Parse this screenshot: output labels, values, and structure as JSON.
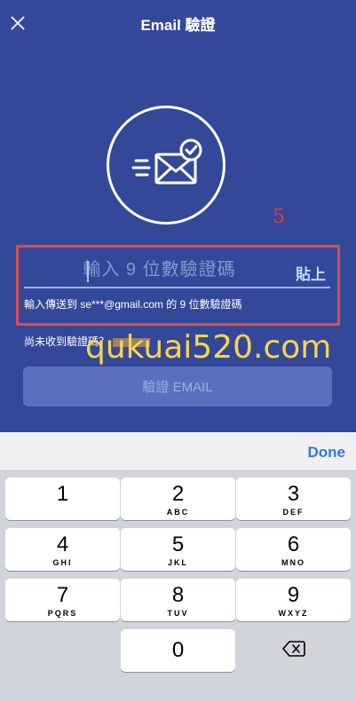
{
  "header": {
    "title": "Email 驗證",
    "close_icon": "close-icon"
  },
  "illustration": {
    "icon": "mail-sent-check-icon"
  },
  "annotation": {
    "number": "5",
    "color": "#e04c4c"
  },
  "code_field": {
    "placeholder": "輸入 9 位數驗證碼",
    "value": "",
    "paste_label": "貼上",
    "hint": "輸入傳送到 se***@gmail.com 的 9 位數驗證碼"
  },
  "resend": {
    "question": "尚未收到驗證碼？"
  },
  "watermark": "qukuai520.com",
  "verify_button": {
    "label": "驗證 EMAIL"
  },
  "keyboard": {
    "done_label": "Done",
    "keys": [
      {
        "num": "1",
        "letters": ""
      },
      {
        "num": "2",
        "letters": "ABC"
      },
      {
        "num": "3",
        "letters": "DEF"
      },
      {
        "num": "4",
        "letters": "GHI"
      },
      {
        "num": "5",
        "letters": "JKL"
      },
      {
        "num": "6",
        "letters": "MNO"
      },
      {
        "num": "7",
        "letters": "PQRS"
      },
      {
        "num": "8",
        "letters": "TUV"
      },
      {
        "num": "9",
        "letters": "WXYZ"
      },
      {
        "num": "0",
        "letters": ""
      }
    ],
    "delete_icon": "backspace-icon"
  },
  "colors": {
    "background": "#34489a",
    "accent": "#2f7ae5",
    "button_disabled": "#5a70bd"
  }
}
